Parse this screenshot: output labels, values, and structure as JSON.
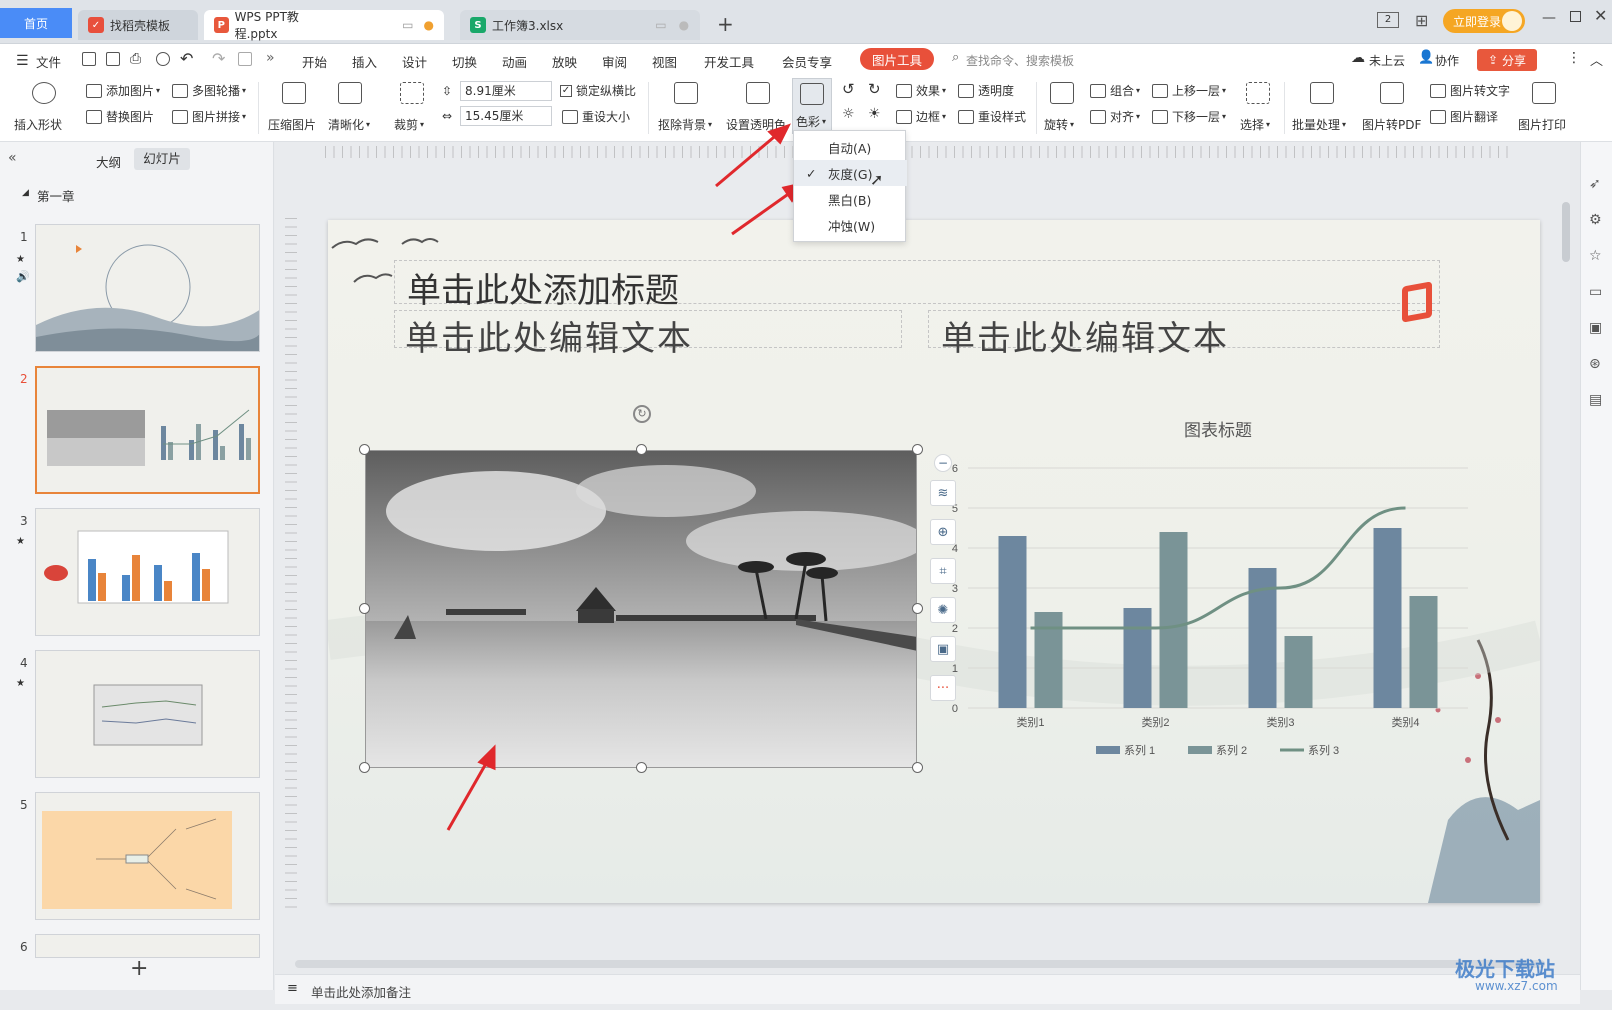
{
  "tabs": [
    {
      "label": "首页",
      "icon": "home-icon"
    },
    {
      "label": "找稻壳模板",
      "icon": "docer-icon"
    },
    {
      "label": "WPS PPT教程.pptx",
      "icon": "ppt-file-icon"
    },
    {
      "label": "工作簿3.xlsx",
      "icon": "xlsx-file-icon"
    }
  ],
  "titlebar": {
    "login": "立即登录",
    "badge": "2"
  },
  "menu": {
    "file": "文件",
    "items": [
      "开始",
      "插入",
      "设计",
      "切换",
      "动画",
      "放映",
      "审阅",
      "视图",
      "开发工具",
      "会员专享"
    ],
    "active_tool": "图片工具",
    "search_placeholder": "查找命令、搜索模板",
    "cloud": "未上云",
    "collab": "协作",
    "share": "分享"
  },
  "ribbon": {
    "insert_shape": "插入形状",
    "add_picture": "添加图片",
    "multi_carousel": "多图轮播",
    "replace_picture": "替换图片",
    "picture_splice": "图片拼接",
    "compress": "压缩图片",
    "sharpen": "清晰化",
    "crop": "裁剪",
    "height": "8.91厘米",
    "width": "15.45厘米",
    "lock_ratio": "锁定纵横比",
    "reset_size": "重设大小",
    "remove_bg": "抠除背景",
    "set_transparent": "设置透明色",
    "color": "色彩",
    "effect": "效果",
    "transparency": "透明度",
    "border": "边框",
    "reset_style": "重设样式",
    "rotate": "旋转",
    "group": "组合",
    "align": "对齐",
    "bring_forward": "上移一层",
    "send_backward": "下移一层",
    "select": "选择",
    "batch": "批量处理",
    "to_pdf": "图片转PDF",
    "to_text": "图片转文字",
    "translate": "图片翻译",
    "print": "图片打印"
  },
  "color_menu": {
    "items": [
      "自动(A)",
      "灰度(G)",
      "黑白(B)",
      "冲蚀(W)"
    ],
    "selected": "灰度(G)"
  },
  "left_panel": {
    "tab_outline": "大纲",
    "tab_slides": "幻灯片",
    "section": "第一章",
    "slide_numbers": [
      "1",
      "2",
      "3",
      "4",
      "5",
      "6"
    ],
    "add": "+"
  },
  "slide": {
    "title": "单击此处添加标题",
    "text_left": "单击此处编辑文本",
    "text_right": "单击此处编辑文本"
  },
  "notes": "单击此处添加备注",
  "watermark": {
    "brand": "极光下载站",
    "url": "www.xz7.com"
  },
  "chart_data": {
    "type": "bar",
    "title": "图表标题",
    "categories": [
      "类别1",
      "类别2",
      "类别3",
      "类别4"
    ],
    "series": [
      {
        "name": "系列 1",
        "type": "bar",
        "color": "#6d879f",
        "values": [
          4.3,
          2.5,
          3.5,
          4.5
        ]
      },
      {
        "name": "系列 2",
        "type": "bar",
        "color": "#7a9497",
        "values": [
          2.4,
          4.4,
          1.8,
          2.8
        ]
      },
      {
        "name": "系列 3",
        "type": "line",
        "color": "#6f9083",
        "values": [
          2,
          2,
          3,
          5
        ]
      }
    ],
    "ylim": [
      0,
      6
    ],
    "yticks": [
      "0",
      "1",
      "2",
      "3",
      "4",
      "5",
      "6"
    ],
    "legend": "bottom",
    "grid": true
  },
  "colors": {
    "accent": "#e8503a",
    "tab_active": "#4a8cf7",
    "login": "#f5a623"
  }
}
